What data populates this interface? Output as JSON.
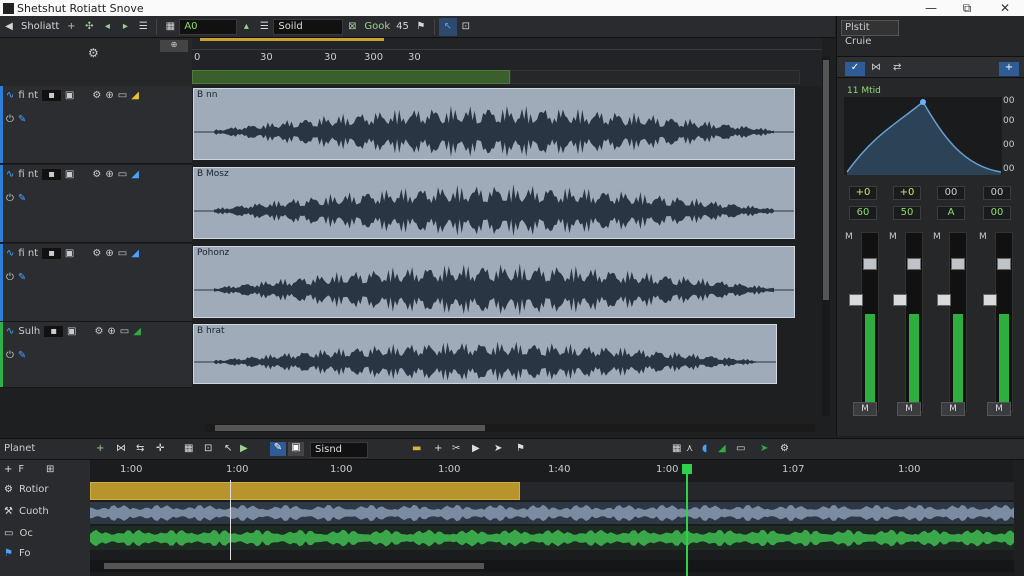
{
  "window": {
    "title": "Shetshut Rotiatt Snove",
    "controls": [
      "—",
      "⧉",
      "✕"
    ]
  },
  "toolbar": {
    "menu_label": "Sholiatt",
    "field_a": "A0",
    "field_b": "Soild",
    "snap_label": "Gook",
    "snap_value": "45",
    "sub_icons": [
      "⚙",
      "⊕"
    ]
  },
  "ruler": {
    "ticks": [
      "0",
      "30",
      "30",
      "300",
      "30"
    ]
  },
  "tracks": [
    {
      "name": "fi nt",
      "clip_label": "B nn",
      "color": "#2b7fd8"
    },
    {
      "name": "fi nt",
      "clip_label": "B Mosz",
      "color": "#2b7fd8"
    },
    {
      "name": "fi nt",
      "clip_label": "Pohonz",
      "color": "#2b7fd8"
    },
    {
      "name": "Sulh",
      "clip_label": "B hrat",
      "color": "#2fb04a"
    }
  ],
  "right_panel": {
    "title": "Plstit Cruie",
    "eq_label": "11 Mtid",
    "eq_ticks": [
      "00",
      "00",
      "00",
      "00"
    ],
    "gain_row1": [
      "+0",
      "+0",
      "00",
      "00"
    ],
    "gain_row2": [
      "60",
      "50",
      "A",
      "00"
    ],
    "channels": [
      {
        "label": "M",
        "level": 0.55,
        "mute": "M"
      },
      {
        "label": "M",
        "level": 0.55,
        "mute": "M"
      },
      {
        "label": "M",
        "level": 0.55,
        "mute": "M"
      },
      {
        "label": "M",
        "level": 0.55,
        "mute": "M"
      }
    ]
  },
  "bottom": {
    "panel_label": "Planet",
    "dropdown": "Sisnd",
    "ruler_ticks": [
      "1:00",
      "1:00",
      "1:00",
      "1:00",
      "1:40",
      "1:00",
      "1:07",
      "1:00"
    ],
    "tracks": [
      {
        "name": "F",
        "icon": "plus-icon"
      },
      {
        "name": "Rotior",
        "icon": "gear-icon"
      },
      {
        "name": "Cuoth",
        "icon": "wrench-icon"
      },
      {
        "name": "Oc",
        "icon": "box-icon"
      },
      {
        "name": "Fo",
        "icon": "flag-icon"
      }
    ]
  },
  "colors": {
    "accent": "#4aa3ff",
    "green": "#2fae40",
    "clip": "#9fabb8",
    "gold": "#b8942c"
  }
}
